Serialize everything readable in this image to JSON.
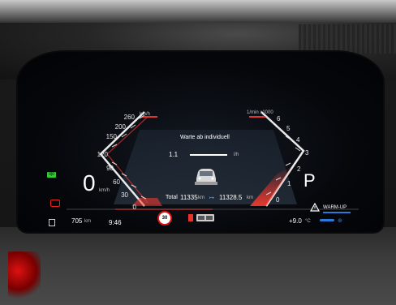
{
  "cluster": {
    "speed_unit": "km/h",
    "speed_ticks": [
      "260",
      "200",
      "150",
      "120",
      "90",
      "60",
      "30",
      "0"
    ],
    "rpm_unit": "1/min x1000",
    "rpm_ticks": [
      "6",
      "5",
      "4",
      "3",
      "2",
      "1",
      "0"
    ],
    "current_speed": "0",
    "current_speed_unit": "km/h",
    "gear": "P",
    "message": "Warte ab individuell",
    "consumption_value": "1.1",
    "consumption_unit": "l/h",
    "total_label": "Total",
    "total_value": "11335",
    "total_unit": "km",
    "trip_value": "11328.5",
    "trip_unit": "km",
    "range_value": "705",
    "range_unit": "km",
    "clock": "9:46",
    "speed_limit": "30",
    "outside_temp": "+9.0",
    "outside_temp_unit": "°C",
    "warmup_label": "WARM-UP",
    "status_icon_green": "0|0",
    "colors": {
      "accent_red": "#e8322d",
      "gauge_white": "#e6e6e6",
      "warmup_blue": "#2a7ad9"
    }
  }
}
